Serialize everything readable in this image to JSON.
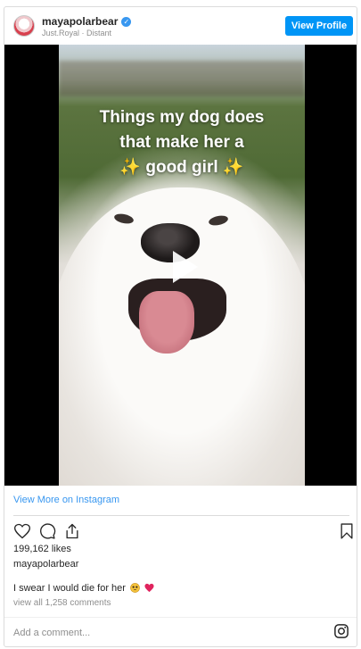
{
  "header": {
    "username": "mayapolarbear",
    "verified_mark": "✓",
    "location": "Just.Royal · Distant",
    "view_profile_label": "View Profile"
  },
  "media": {
    "overlay_line1": "Things my dog does",
    "overlay_line2": "that make her a",
    "overlay_line3": "good girl",
    "sparkle": "✨",
    "play_icon": "play-icon"
  },
  "footer": {
    "view_more_label": "View More on Instagram",
    "likes": "199,162 likes",
    "owner": "mayapolarbear",
    "caption": "I swear I would die for her",
    "view_all_comments": "view all 1,258 comments",
    "comment_placeholder": "Add a comment..."
  },
  "icons": [
    "heart-icon",
    "comment-icon",
    "share-icon",
    "bookmark-icon",
    "instagram-icon",
    "verified-icon"
  ],
  "colors": {
    "accent": "#0095f6",
    "link": "#3897f0",
    "muted": "#8e8e8e",
    "heart": "#e0245e"
  }
}
